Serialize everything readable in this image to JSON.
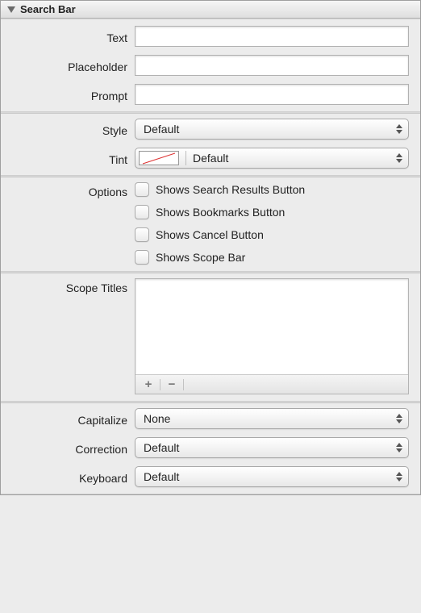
{
  "header": {
    "title": "Search Bar"
  },
  "text_group": {
    "text_label": "Text",
    "text_value": "",
    "placeholder_label": "Placeholder",
    "placeholder_value": "",
    "prompt_label": "Prompt",
    "prompt_value": ""
  },
  "style_group": {
    "style_label": "Style",
    "style_value": "Default",
    "tint_label": "Tint",
    "tint_value": "Default"
  },
  "options_group": {
    "options_label": "Options",
    "items": [
      {
        "label": "Shows Search Results Button",
        "checked": false
      },
      {
        "label": "Shows Bookmarks Button",
        "checked": false
      },
      {
        "label": "Shows Cancel Button",
        "checked": false
      },
      {
        "label": "Shows Scope Bar",
        "checked": false
      }
    ]
  },
  "scope_group": {
    "scope_label": "Scope Titles",
    "add_label": "+",
    "remove_label": "−"
  },
  "text_input_group": {
    "capitalize_label": "Capitalize",
    "capitalize_value": "None",
    "correction_label": "Correction",
    "correction_value": "Default",
    "keyboard_label": "Keyboard",
    "keyboard_value": "Default"
  }
}
